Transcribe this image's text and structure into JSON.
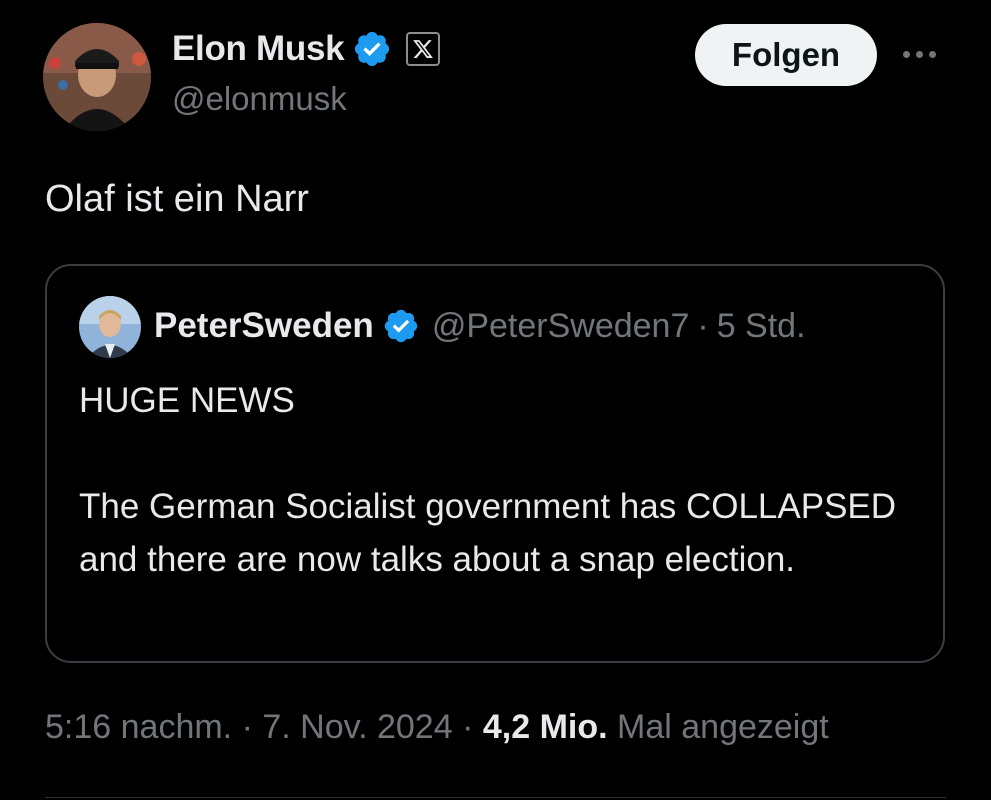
{
  "author": {
    "name": "Elon Musk",
    "handle": "@elonmusk",
    "verified_color": "#1d9bf0",
    "affiliation_badge": "x-logo-icon"
  },
  "follow_button": {
    "label": "Folgen"
  },
  "more_menu": {
    "icon": "more-horizontal-icon"
  },
  "tweet": {
    "text": "Olaf ist ein Narr"
  },
  "quoted_tweet": {
    "name": "PeterSweden",
    "handle": "@PeterSweden7",
    "separator": "·",
    "time": "5 Std.",
    "paragraphs": [
      "HUGE NEWS",
      "The German Socialist government has COLLAPSED and there are now talks about a snap election."
    ]
  },
  "meta": {
    "time": "5:16 nachm.",
    "sep1": "·",
    "date": "7. Nov. 2024",
    "sep2": "·",
    "views_count": "4,2 Mio.",
    "views_label": "Mal angezeigt"
  }
}
